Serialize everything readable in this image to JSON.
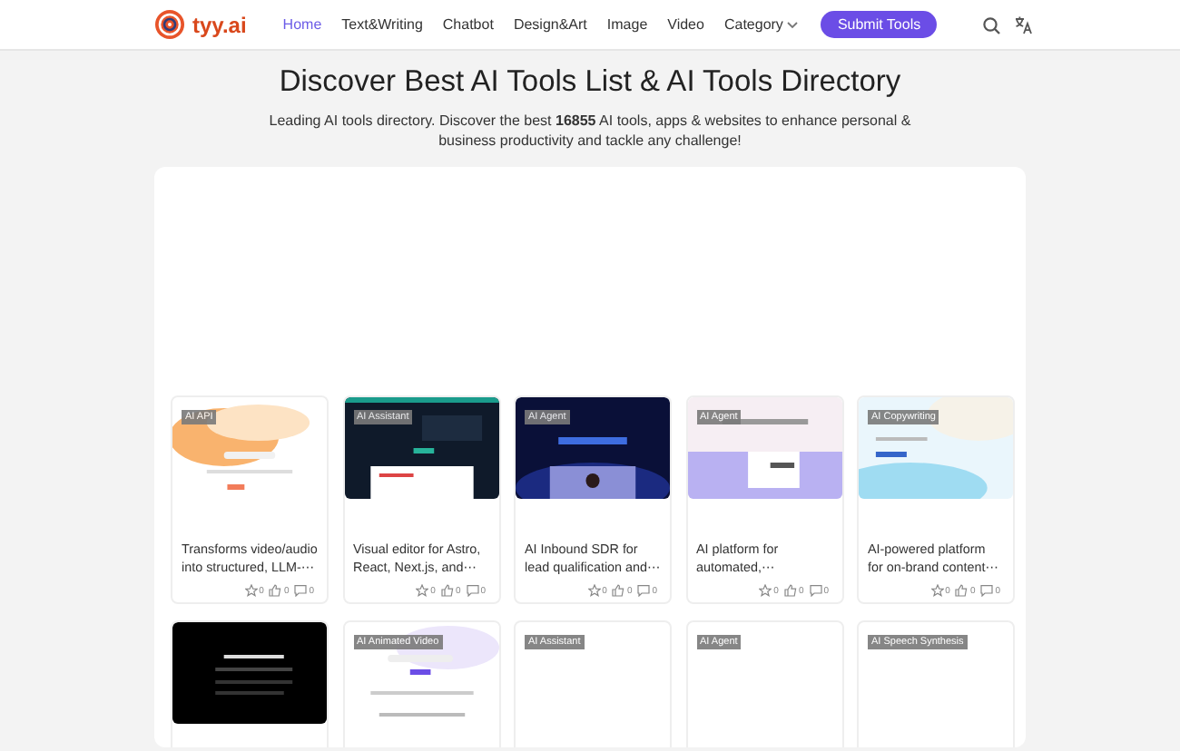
{
  "header": {
    "brand": "tyy.ai",
    "nav": [
      {
        "label": "Home",
        "selected": true
      },
      {
        "label": "Text&Writing",
        "selected": false
      },
      {
        "label": "Chatbot",
        "selected": false
      },
      {
        "label": "Design&Art",
        "selected": false
      },
      {
        "label": "Image",
        "selected": false
      },
      {
        "label": "Video",
        "selected": false
      },
      {
        "label": "Category",
        "selected": false,
        "dropdown": true
      }
    ],
    "submit_button": "Submit Tools"
  },
  "hero": {
    "title": "Discover Best AI Tools List & AI Tools Directory",
    "subtitle": "Leading AI tools directory. Discover the best **16855** AI tools, apps & websites to enhance personal & business productivity and tackle any challenge!"
  },
  "cards": [
    {
      "tag": "AI API",
      "thumbnail": {
        "kind": "picture"
      },
      "description": "Transforms video/audio into structured, LLM-⋯",
      "stars": "0",
      "likes": "0",
      "comments": "0"
    },
    {
      "tag": "AI Assistant",
      "thumbnail": {
        "kind": "picture"
      },
      "description": "Visual editor for Astro, React, Next.js, and⋯",
      "stars": "0",
      "likes": "0",
      "comments": "0"
    },
    {
      "tag": "AI Agent",
      "thumbnail": {
        "kind": "picture"
      },
      "description": "AI Inbound SDR for lead qualification and⋯",
      "stars": "0",
      "likes": "0",
      "comments": "0"
    },
    {
      "tag": "AI Agent",
      "thumbnail": {
        "kind": "picture"
      },
      "description": "AI platform for automated,⋯",
      "stars": "0",
      "likes": "0",
      "comments": "0"
    },
    {
      "tag": "AI Copywriting",
      "thumbnail": {
        "kind": "picture"
      },
      "description": "AI-powered platform for on-brand content⋯",
      "stars": "0",
      "likes": "0",
      "comments": "0"
    },
    {
      "thumbnail": {
        "kind": "picture"
      }
    },
    {
      "tag": "AI Animated Video",
      "thumbnail": {
        "kind": "picture"
      }
    },
    {
      "tag": "AI Assistant"
    },
    {
      "tag": "AI Agent"
    },
    {
      "tag": "AI Speech Synthesis"
    }
  ]
}
